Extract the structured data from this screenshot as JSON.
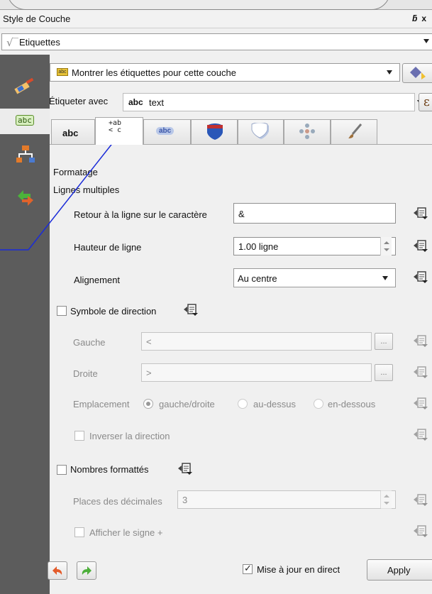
{
  "window": {
    "title": "Style de Couche",
    "controls": "ʃ x"
  },
  "renderer": {
    "selected": "Etiquettes",
    "icon": "label-renderer-icon"
  },
  "labeling": {
    "show_labels": "Montrer les étiquettes pour cette couche",
    "label_with_text": "Étiqueter avec",
    "field_type_badge": "abc",
    "field_value": "text",
    "expression_button": "ε"
  },
  "tabs": [
    {
      "name": "text",
      "label": "abc",
      "active": false
    },
    {
      "name": "formatting",
      "label": "+ab\n< c",
      "active": true
    },
    {
      "name": "buffer",
      "label": "abc",
      "active": false
    },
    {
      "name": "background",
      "label": "",
      "active": false
    },
    {
      "name": "shadow",
      "label": "",
      "active": false
    },
    {
      "name": "placement",
      "label": "",
      "active": false
    },
    {
      "name": "rendering",
      "label": "",
      "active": false
    }
  ],
  "formatting": {
    "section_title": "Formatage",
    "multiline_title": "Lignes multiples",
    "wrap_label": "Retour à la ligne sur le caractère",
    "wrap_value": "&",
    "line_height_label": "Hauteur de ligne",
    "line_height_value": "1.00 ligne",
    "alignment_label": "Alignement",
    "alignment_value": "Au centre",
    "direction_symbol_label": "Symbole de direction",
    "left_label": "Gauche",
    "left_value": "<",
    "right_label": "Droite",
    "right_value": ">",
    "placement_label": "Emplacement",
    "placement_options": [
      "gauche/droite",
      "au-dessus",
      "en-dessous"
    ],
    "placement_selected": "gauche/droite",
    "reverse_label": "Inverser la direction",
    "formatted_numbers_label": "Nombres formattés",
    "decimals_label": "Places des décimales",
    "decimals_value": "3",
    "plus_sign_label": "Afficher le signe +",
    "browse_label": "..."
  },
  "footer": {
    "live_update_label": "Mise à jour en direct",
    "live_update_checked": true,
    "apply_label": "Apply"
  },
  "colors": {
    "sidebar": "#5c5c5c",
    "accent_line": "#1a2bd8",
    "panel": "#f0f0f0"
  }
}
